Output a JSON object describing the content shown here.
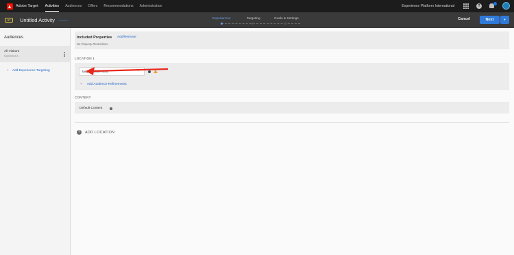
{
  "topnav": {
    "app_name": "Adobe Target",
    "links": [
      "Activities",
      "Audiences",
      "Offers",
      "Recommendations",
      "Administration"
    ],
    "active_link": "Activities",
    "org_name": "Experience Platform International"
  },
  "header": {
    "type_badge": "XT",
    "activity_name": "Untitled Activity",
    "activity_sub": "Inactive",
    "steps": [
      "Experiences",
      "Targeting",
      "Goals & Settings"
    ],
    "active_step": "Experiences",
    "cancel_label": "Cancel",
    "next_label": "Next",
    "next_dropdown": "▾"
  },
  "sidebar": {
    "title": "Audiences",
    "audience": {
      "name": "All Visitors",
      "sub": "Experience A"
    },
    "add_targeting": "Add Experience Targeting",
    "add_plus": "+"
  },
  "main": {
    "properties": {
      "title": "Included Properties",
      "link": "Add/Remove",
      "sub": "No Property Restrictions"
    },
    "location": {
      "label": "LOCATION 1",
      "mbox_value": "target-global-mbox",
      "refine_label": "Add Audience Refinements",
      "refine_plus": "+"
    },
    "content": {
      "label": "CONTENT",
      "default_label": "Default Content"
    },
    "add_location": "ADD LOCATION",
    "add_location_plus": "+"
  },
  "colors": {
    "accent": "#2f7ad8",
    "link": "#1f63c9",
    "warning": "#e8a33d",
    "arrow": "#e8281e"
  }
}
